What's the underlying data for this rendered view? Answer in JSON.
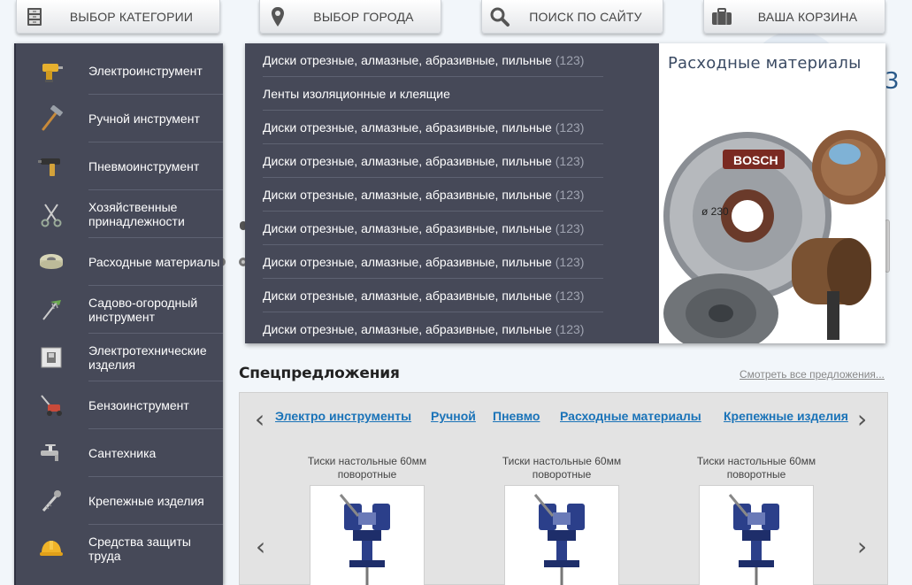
{
  "nav": {
    "category_label": "Выбор категории",
    "city_label": "Выбор города",
    "search_label": "Поиск по сайту",
    "cart_label": "Ваша корзина"
  },
  "categories": [
    {
      "label": "Электроинструмент",
      "icon": "drill-icon"
    },
    {
      "label": "Ручной инструмент",
      "icon": "hammer-icon"
    },
    {
      "label": "Пневмоинструмент",
      "icon": "pneumatic-gun-icon"
    },
    {
      "label": "Хозяйственные принадлежности",
      "icon": "scissors-icon"
    },
    {
      "label": "Расходные материалы",
      "icon": "tape-icon"
    },
    {
      "label": "Садово-огородный инструмент",
      "icon": "rake-icon"
    },
    {
      "label": "Электротехнические изделия",
      "icon": "switch-icon"
    },
    {
      "label": "Бензоинструмент",
      "icon": "lawnmower-icon"
    },
    {
      "label": "Сантехника",
      "icon": "faucet-icon"
    },
    {
      "label": "Крепежные изделия",
      "icon": "screw-icon"
    },
    {
      "label": "Средства защиты труда",
      "icon": "helmet-icon"
    }
  ],
  "submenu": {
    "items": [
      {
        "label": "Диски отрезные, алмазные, абразивные, пильные",
        "count": "(123)"
      },
      {
        "label": "Ленты изоляционные и клеящие",
        "count": ""
      },
      {
        "label": "Диски отрезные, алмазные, абразивные, пильные",
        "count": "(123)"
      },
      {
        "label": "Диски отрезные, алмазные, абразивные, пильные",
        "count": "(123)"
      },
      {
        "label": "Диски отрезные, алмазные, абразивные, пильные",
        "count": "(123)"
      },
      {
        "label": "Диски отрезные, алмазные, абразивные, пильные",
        "count": "(123)"
      },
      {
        "label": "Диски отрезные, алмазные, абразивные, пильные",
        "count": "(123)"
      },
      {
        "label": "Диски отрезные, алмазные, абразивные, пильные",
        "count": "(123)"
      },
      {
        "label": "Диски отрезные, алмазные, абразивные, пильные",
        "count": "(123)"
      }
    ],
    "promo_title": "Расходные материалы",
    "promo_brand": "BOSCH",
    "promo_disc_size": "ø 230"
  },
  "special": {
    "title": "Спецпредложения",
    "see_all": "Смотреть все предложения...",
    "tabs": [
      "Электро инструменты",
      "Ручной",
      "Пневмо",
      "Расходные материалы",
      "Крепежные изделия"
    ],
    "products": [
      {
        "name": "Тиски настольные 60мм поворотные"
      },
      {
        "name": "Тиски настольные 60мм поворотные"
      },
      {
        "name": "Тиски настольные 60мм поворотные"
      }
    ]
  },
  "colors": {
    "panel": "#464958",
    "link": "#1a73b8",
    "count": "#9fa3b0"
  }
}
